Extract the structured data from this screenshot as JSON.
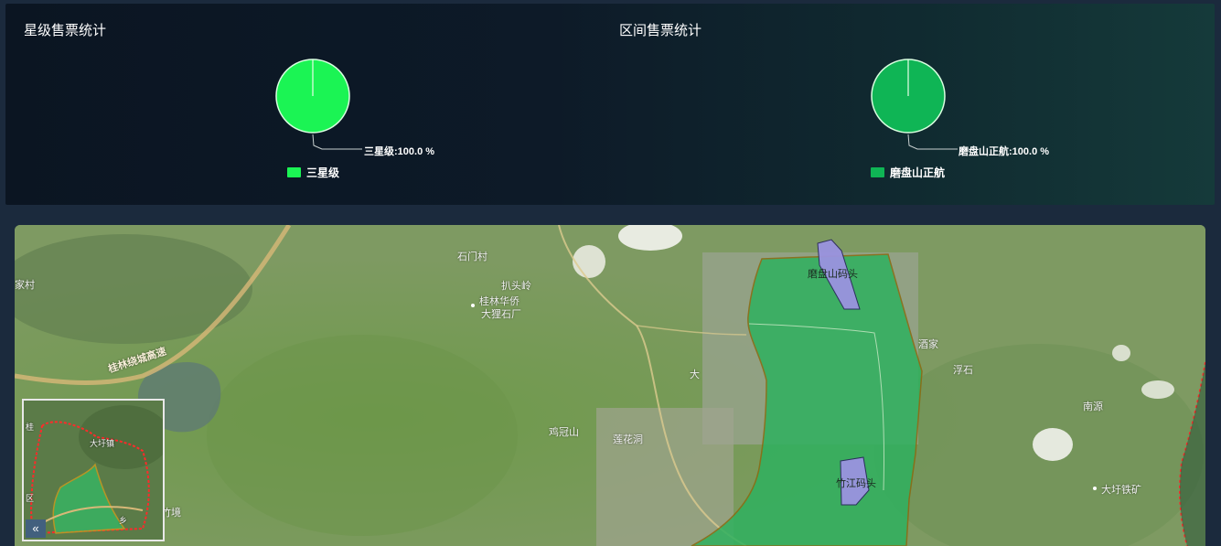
{
  "star_stats": {
    "title": "星级售票统计",
    "pie_label": "三星级:100.0 %",
    "legend": "三星级",
    "color": "#1bf454"
  },
  "section_stats": {
    "title": "区间售票统计",
    "pie_label": "磨盘山正航:100.0 %",
    "legend": "磨盘山正航",
    "color": "#0fb555"
  },
  "map": {
    "labels": {
      "shimencun": "石门村",
      "jiacun": "家村",
      "patouling": "扒头岭",
      "guilin_huaqiao": "桂林华侨",
      "dali_shichang": "大狸石厂",
      "highway": "桂林绕城高速",
      "da": "大",
      "jiguanshan": "鸡冠山",
      "lianhuadong": "莲花洞",
      "jiujia": "酒家",
      "fushi": "浮石",
      "nanyuan": "南源",
      "dayu_tiekuang": "大圩铁矿",
      "mopanshan_matou": "磨盘山码头",
      "zhujiang_matou": "竹江码头",
      "zhujing": "竹境"
    },
    "overview": {
      "collapse_label": "«",
      "labels": {
        "t1": "桂",
        "t2": "大圩镇",
        "t3": "乡",
        "t4": "区"
      }
    }
  }
}
